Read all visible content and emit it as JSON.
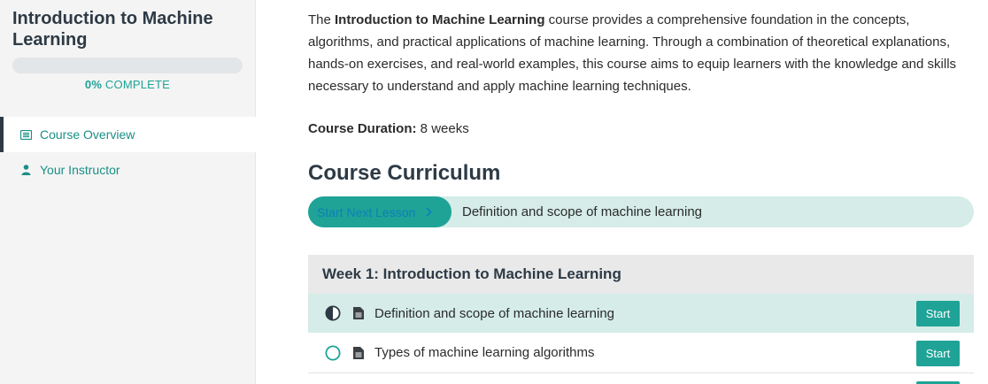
{
  "course": {
    "title": "Introduction to Machine Learning",
    "progress_percent": 0,
    "progress_percent_label": "0%",
    "progress_suffix": " COMPLETE"
  },
  "nav": {
    "items": [
      {
        "label": "Course Overview",
        "icon": "list-icon",
        "active": true
      },
      {
        "label": "Your Instructor",
        "icon": "user-icon",
        "active": false
      }
    ]
  },
  "main": {
    "intro": {
      "prefix": "The ",
      "bold": "Introduction to Machine Learning",
      "rest": " course provides a comprehensive foundation in the concepts, algorithms, and practical applications of machine learning. Through a combination of theoretical explanations, hands-on exercises, and real-world examples, this course aims to equip learners with the knowledge and skills necessary to understand and apply machine learning techniques."
    },
    "duration": {
      "label": "Course Duration:",
      "value": " 8 weeks"
    },
    "curriculum_title": "Course Curriculum",
    "next": {
      "button_label": "Start Next Lesson",
      "lesson": "Definition and scope of machine learning"
    },
    "week": {
      "title": "Week 1: Introduction to Machine Learning",
      "lessons": [
        {
          "title": "Definition and scope of machine learning",
          "status": "in-progress",
          "button": "Start"
        },
        {
          "title": "Types of machine learning algorithms",
          "status": "not-started",
          "button": "Start"
        }
      ]
    }
  },
  "colors": {
    "accent": "#1fa397",
    "accent_light": "#d5ece8",
    "dark": "#2d3a45"
  }
}
